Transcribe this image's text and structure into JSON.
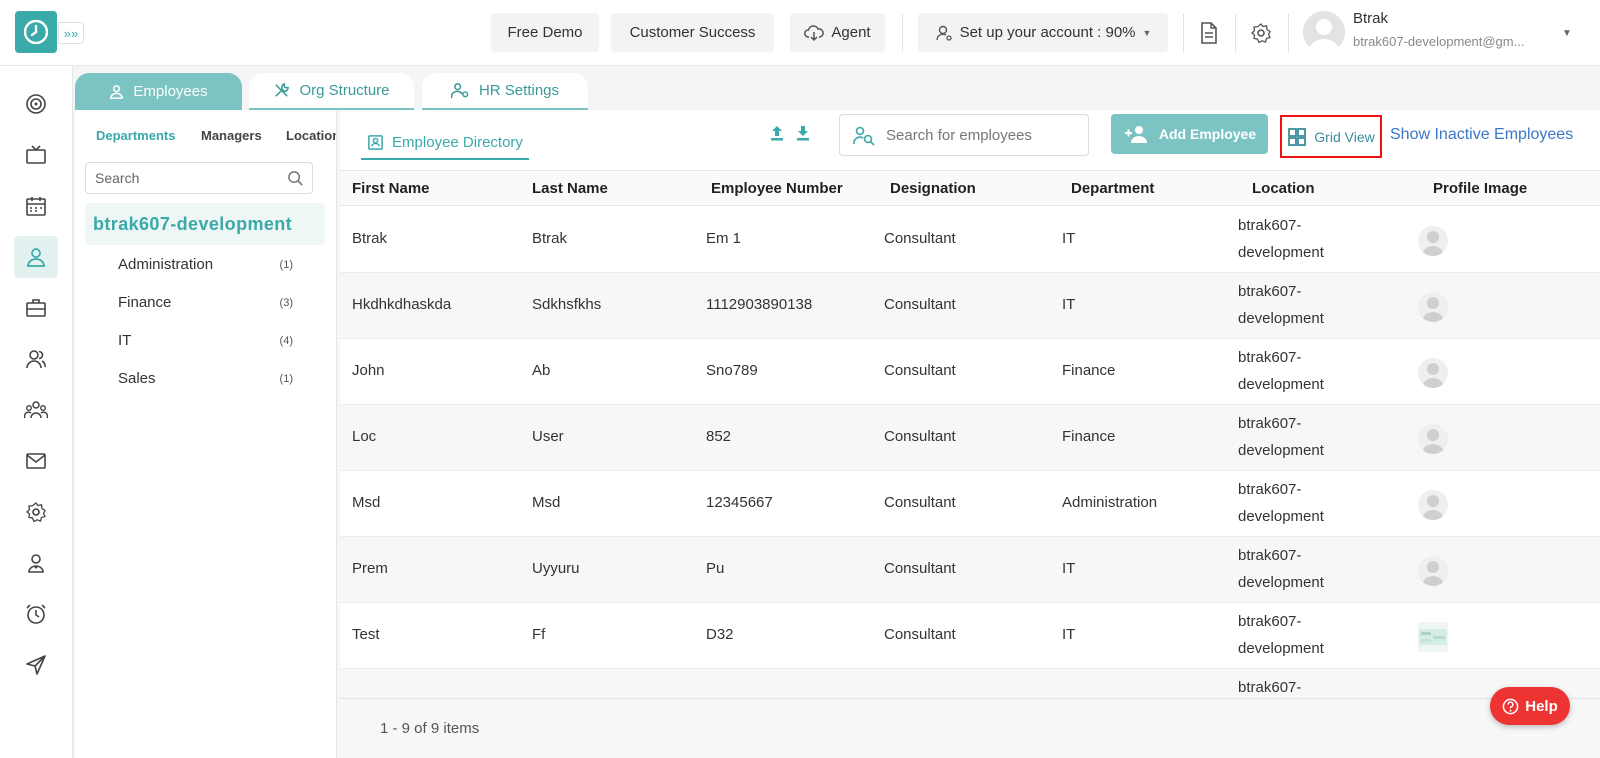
{
  "header": {
    "free_demo": "Free Demo",
    "customer_success": "Customer Success",
    "agent": "Agent",
    "setup": "Set up your account : 90%",
    "user_name": "Btrak",
    "user_email": "btrak607-development@gm..."
  },
  "tabs": {
    "employees": "Employees",
    "org_structure": "Org Structure",
    "hr_settings": "HR Settings"
  },
  "left_panel": {
    "tabs": [
      "Departments",
      "Managers",
      "Locations"
    ],
    "search_placeholder": "Search",
    "org_name": "btrak607-development",
    "departments": [
      {
        "name": "Administration",
        "count": "(1)"
      },
      {
        "name": "Finance",
        "count": "(3)"
      },
      {
        "name": "IT",
        "count": "(4)"
      },
      {
        "name": "Sales",
        "count": "(1)"
      }
    ]
  },
  "main": {
    "directory_tab": "Employee Directory",
    "search_placeholder": "Search for employees",
    "add_employee": "Add Employee",
    "grid_view": "Grid View",
    "show_inactive": "Show Inactive Employees",
    "columns": [
      "First Name",
      "Last Name",
      "Employee Number",
      "Designation",
      "Department",
      "Location",
      "Profile Image"
    ],
    "rows": [
      {
        "first": "Btrak",
        "last": "Btrak",
        "number": "Em 1",
        "designation": "Consultant",
        "department": "IT",
        "loc1": "btrak607-",
        "loc2": "development"
      },
      {
        "first": "Hkdhkdhaskda",
        "last": "Sdkhsfkhs",
        "number": "1112903890138",
        "designation": "Consultant",
        "department": "IT",
        "loc1": "btrak607-",
        "loc2": "development"
      },
      {
        "first": "John",
        "last": "Ab",
        "number": "Sno789",
        "designation": "Consultant",
        "department": "Finance",
        "loc1": "btrak607-",
        "loc2": "development"
      },
      {
        "first": "Loc",
        "last": "User",
        "number": "852",
        "designation": "Consultant",
        "department": "Finance",
        "loc1": "btrak607-",
        "loc2": "development"
      },
      {
        "first": "Msd",
        "last": "Msd",
        "number": "12345667",
        "designation": "Consultant",
        "department": "Administration",
        "loc1": "btrak607-",
        "loc2": "development"
      },
      {
        "first": "Prem",
        "last": "Uyyuru",
        "number": "Pu",
        "designation": "Consultant",
        "department": "IT",
        "loc1": "btrak607-",
        "loc2": "development"
      },
      {
        "first": "Test",
        "last": "Ff",
        "number": "D32",
        "designation": "Consultant",
        "department": "IT",
        "loc1": "btrak607-",
        "loc2": "development"
      },
      {
        "first": "",
        "last": "",
        "number": "",
        "designation": "",
        "department": "",
        "loc1": "btrak607-",
        "loc2": ""
      }
    ],
    "pager": "1 - 9 of 9 items"
  },
  "help": "Help",
  "colors": {
    "accent": "#3aa9a9",
    "accent_light": "#7cc3c3",
    "link": "#3b77c4",
    "highlight_border": "#e11111",
    "help": "#e33333"
  }
}
